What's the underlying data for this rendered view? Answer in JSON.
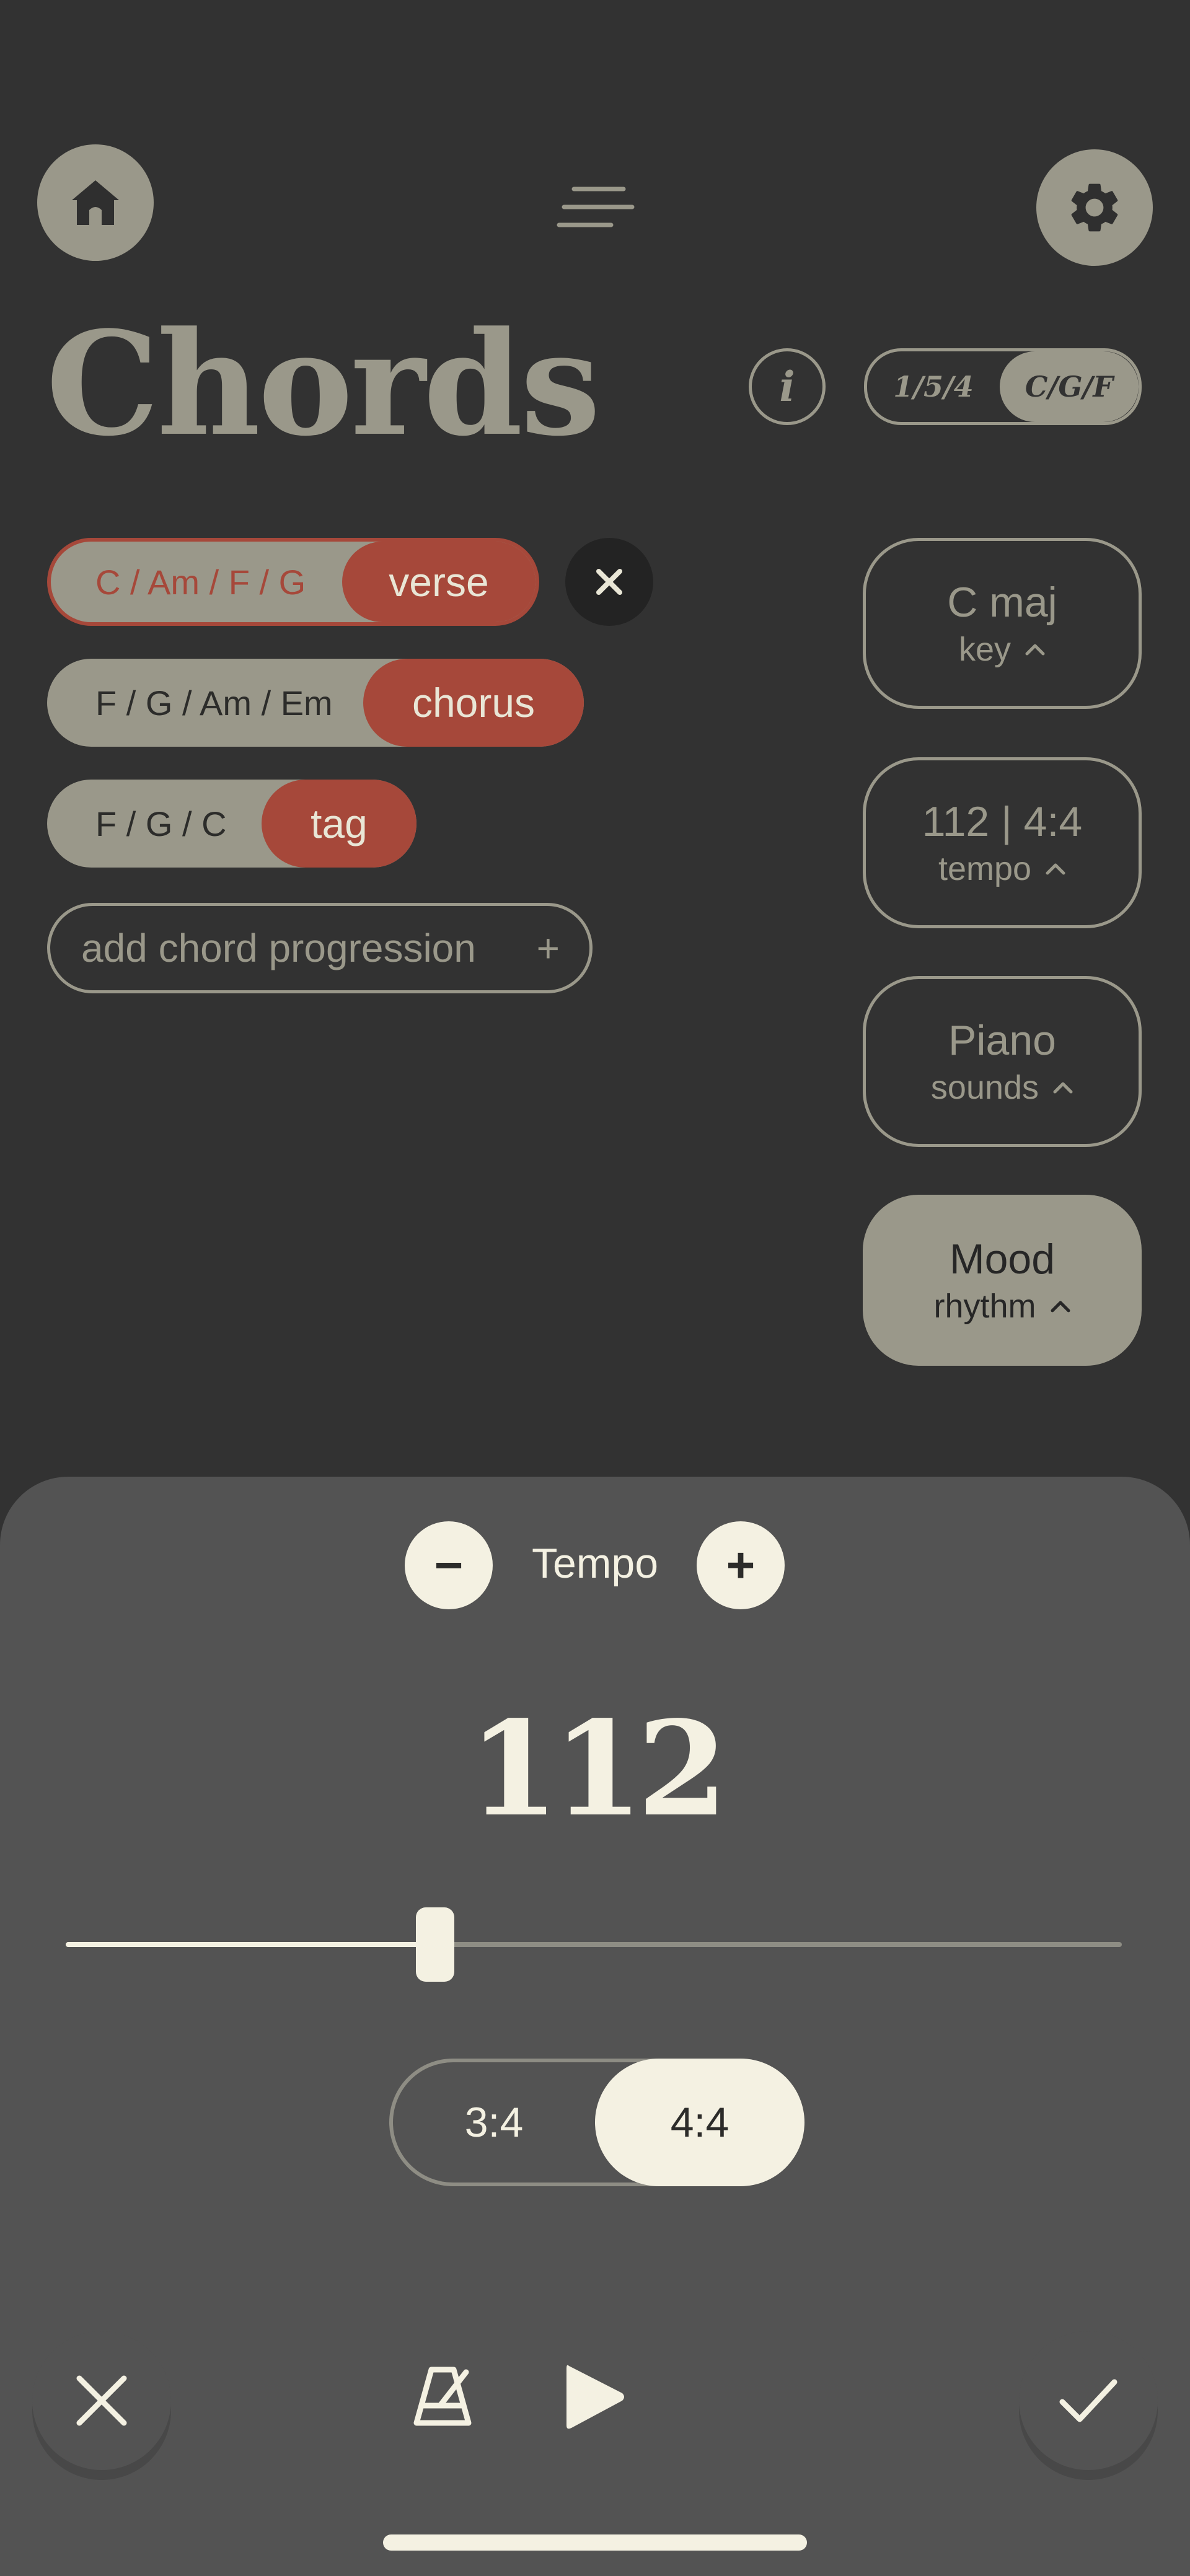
{
  "header": {
    "home_icon": "home-icon",
    "menu_icon": "menu-icon",
    "settings_icon": "gear-icon",
    "title": "Chords",
    "info_label": "i",
    "notation_toggle": {
      "options": [
        "1/5/4",
        "C/G/F"
      ],
      "selected": "C/G/F"
    }
  },
  "progressions": [
    {
      "chords": "C / Am / F / G",
      "section": "verse",
      "selected": true
    },
    {
      "chords": "F / G / Am / Em",
      "section": "chorus",
      "selected": false
    },
    {
      "chords": "F / G / C",
      "section": "tag",
      "selected": false
    }
  ],
  "add_progression": {
    "label": "add chord progression",
    "icon": "+"
  },
  "side_controls": [
    {
      "value": "C maj",
      "label": "key"
    },
    {
      "value": "112 | 4:4",
      "label": "tempo"
    },
    {
      "value": "Piano",
      "label": "sounds"
    },
    {
      "value": "Mood",
      "label": "rhythm",
      "active": true
    }
  ],
  "tempo_sheet": {
    "title": "Tempo",
    "minus": "−",
    "plus": "+",
    "bpm": "112",
    "slider_fraction": 0.35,
    "time_signatures": [
      "3:4",
      "4:4"
    ],
    "selected_signature": "4:4"
  },
  "bottom_bar": {
    "cancel_icon": "close-icon",
    "metronome_icon": "metronome-icon",
    "play_icon": "play-icon",
    "confirm_icon": "check-icon"
  },
  "colors": {
    "background": "#323232",
    "sheet": "#535353",
    "accent": "#a6483a",
    "muted": "#9a988a",
    "cream": "#f4f1e2"
  }
}
